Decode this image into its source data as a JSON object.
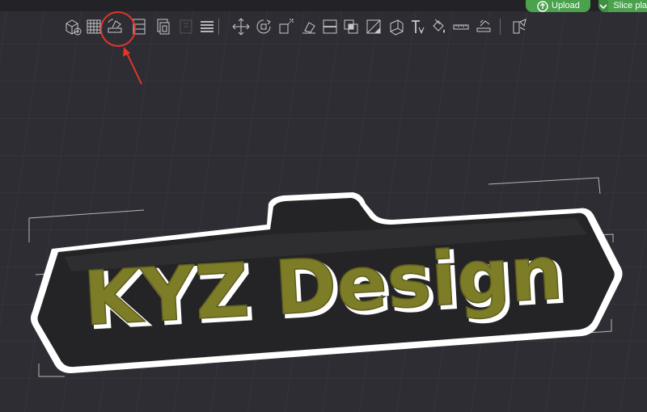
{
  "topbar": {
    "upload_label": "Upload",
    "slice_label": "Slice pla",
    "accent_color": "#4aa24d"
  },
  "toolbar": {
    "tools": [
      {
        "icon": "add-cube-icon"
      },
      {
        "icon": "grid-plate-icon"
      },
      {
        "icon": "auto-orient-icon",
        "highlighted": true
      },
      {
        "icon": "arrange-icon"
      },
      {
        "icon": "copy-plate-icon"
      },
      {
        "icon": "plate-settings-icon",
        "disabled": true
      },
      {
        "icon": "layers-icon"
      },
      {
        "icon": "move-icon"
      },
      {
        "icon": "rotate-icon"
      },
      {
        "icon": "scale-icon"
      },
      {
        "icon": "lay-on-face-icon"
      },
      {
        "icon": "cut-icon"
      },
      {
        "icon": "boolean-icon"
      },
      {
        "icon": "support-paint-icon"
      },
      {
        "icon": "seam-paint-icon"
      },
      {
        "icon": "text-tool-icon"
      },
      {
        "icon": "color-paint-icon"
      },
      {
        "icon": "measure-icon"
      },
      {
        "icon": "assembly-icon"
      },
      {
        "icon": "variable-layer-icon"
      }
    ]
  },
  "scene": {
    "model_text": "KYZ Design",
    "text_color": "#7d7c27",
    "base_color": "#242426",
    "outline_color": "#ffffff",
    "annotation_color": "#e0362a"
  }
}
